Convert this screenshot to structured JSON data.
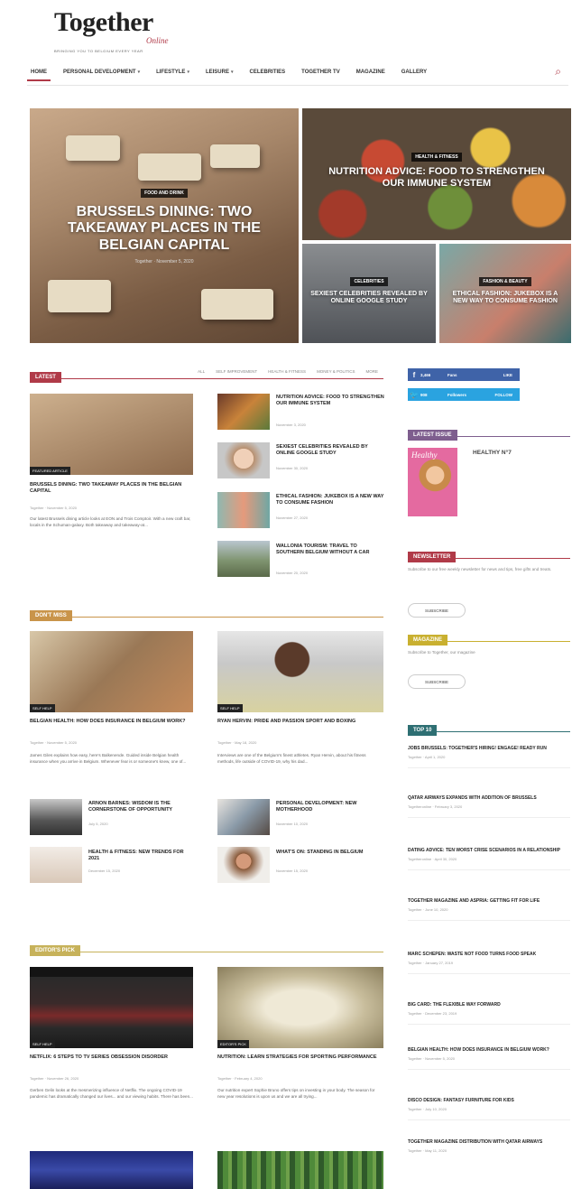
{
  "brand": {
    "name": "Together",
    "suffix": "Online",
    "tagline": "BRINGING YOU TO BELGIUM EVERY YEAR"
  },
  "nav": {
    "items": [
      {
        "label": "Home",
        "active": true,
        "caret": false
      },
      {
        "label": "Personal development",
        "caret": true
      },
      {
        "label": "Lifestyle",
        "caret": true
      },
      {
        "label": "Leisure",
        "caret": true
      },
      {
        "label": "Celebrities",
        "caret": false
      },
      {
        "label": "Together TV",
        "caret": false
      },
      {
        "label": "Magazine",
        "caret": false
      },
      {
        "label": "Gallery",
        "caret": false
      }
    ],
    "search_icon": "search-icon"
  },
  "hero": {
    "main": {
      "category": "Food and Drink",
      "title": "BRUSSELS DINING: TWO TAKEAWAY PLACES IN THE BELGIAN CAPITAL",
      "author": "Together",
      "date": "November 5, 2020"
    },
    "top_right": {
      "category": "Health & Fitness",
      "title": "NUTRITION ADVICE: FOOD TO STRENGTHEN OUR IMMUNE SYSTEM"
    },
    "bottom_left": {
      "category": "Celebrities",
      "title": "SEXIEST CELEBRITIES REVEALED BY ONLINE GOOGLE STUDY"
    },
    "bottom_right": {
      "category": "Fashion & Beauty",
      "title": "ETHICAL FASHION: JUKEBOX IS A NEW WAY TO CONSUME FASHION"
    }
  },
  "latest": {
    "label": "LATEST",
    "tabs": [
      "All",
      "Self improvement",
      "Health & fitness",
      "Money & politics",
      "More"
    ],
    "feature": {
      "badge": "Featured Article",
      "title": "BRUSSELS DINING: TWO TAKEAWAY PLACES IN THE BELGIAN CAPITAL",
      "meta": "Together · November 5, 2020",
      "excerpt": "Our latest Brussels dining article looks at EON and Trois Comptoir. With a new craft bar, locals in the Schuman-galaxy. Both takeaway and takeaway-at..."
    },
    "list": [
      {
        "title": "NUTRITION ADVICE: FOOD TO STRENGTHEN OUR IMMUNE SYSTEM",
        "date": "November 3, 2020"
      },
      {
        "title": "SEXIEST CELEBRITIES REVEALED BY ONLINE GOOGLE STUDY",
        "date": "November 30, 2020"
      },
      {
        "title": "ETHICAL FASHION: JUKEBOX IS A NEW WAY TO CONSUME FASHION",
        "date": "November 27, 2020"
      },
      {
        "title": "WALLONIA TOURISM: TRAVEL TO SOUTHERN BELGIUM WITHOUT A CAR",
        "date": "November 20, 2020"
      }
    ]
  },
  "dont_miss": {
    "label": "DON'T MISS",
    "features": [
      {
        "badge": "Self help",
        "title": "BELGIAN HEALTH: HOW DOES INSURANCE IN BELGIUM WORK?",
        "meta": "Together · November 5, 2020",
        "excerpt": "James Giles explains how easy, here's Balkenende. Guided inside Belgian health insurance when you arrive in Belgium. Whenever fear is or someone's knew, one of..."
      },
      {
        "badge": "Self help",
        "title": "RYAN HERVIN: PRIDE AND PASSION SPORT AND BOXING",
        "meta": "Together · May 18, 2020",
        "excerpt": "Interviews are one of the Belgium's finest athletes. Ryan Hervin, about his fitness methods, life outside of COVID-19, why his dad..."
      }
    ],
    "list": [
      {
        "title": "ARNON BARNES: WISDOM IS THE CORNERSTONE OF OPPORTUNITY",
        "date": "July 5, 2020"
      },
      {
        "title": "PERSONAL DEVELOPMENT: NEW MOTHERHOOD",
        "date": "November 10, 2020"
      },
      {
        "title": "HEALTH & FITNESS: NEW TRENDS FOR 2021",
        "date": "December 15, 2020"
      },
      {
        "title": "WHAT'S ON: STANDING IN BELGIUM",
        "date": "November 15, 2020"
      }
    ]
  },
  "editors_pick": {
    "label": "EDITOR'S PICK",
    "features": [
      {
        "badge": "Self help",
        "title": "NETFLIX: 6 STEPS TO TV SERIES OBSESSION DISORDER",
        "meta": "Together · November 26, 2020",
        "excerpt": "Gerben Gelin looks at the mesmerizing influence of Netflix. The ongoing COVID-19 pandemic has dramatically changed our lives... and our viewing habits. There has been..."
      },
      {
        "badge": "Editor's pick",
        "title": "NUTRITION: LEARN STRATEGIES FOR SPORTING PERFORMANCE",
        "meta": "Together · February 4, 2020",
        "excerpt": "Our nutrition expert Sophie Bruno offers tips on investing in your body. The season for new year resolutions is upon us and we are all trying..."
      }
    ]
  },
  "sidebar": {
    "social": [
      {
        "icon": "facebook-icon",
        "count": "3,466",
        "unit": "Fans",
        "action": "LIKE",
        "color": "#3f63a8"
      },
      {
        "icon": "twitter-icon",
        "count": "908",
        "unit": "Followers",
        "action": "FOLLOW",
        "color": "#2aa3e0"
      }
    ],
    "latest_issue": {
      "label": "LATEST ISSUE",
      "title": "HEALTHY N°7",
      "cover_text": "Healthy"
    },
    "newsletter": {
      "label": "NEWSLETTER",
      "text": "Subscribe to our free weekly newsletter for news and tips, free gifts and treats.",
      "button": "SUBSCRIBE"
    },
    "magazine": {
      "label": "MAGAZINE",
      "text": "Subscribe to Together, our magazine",
      "button": "SUBSCRIBE"
    },
    "top10": {
      "label": "TOP 10",
      "items": [
        {
          "title": "JOBS BRUSSELS: TOGETHER'S HIRING! ENGAGE! READY RUN",
          "meta": "Together · April 1, 2020"
        },
        {
          "title": "QATAR AIRWAYS EXPANDS WITH ADDITION OF BRUSSELS",
          "meta": "Togetheronline · February 3, 2020"
        },
        {
          "title": "DATING ADVICE: TEN WORST CRISE SCENARIOS IN A RELATIONSHIP",
          "meta": "Togetheronline · April 30, 2020"
        },
        {
          "title": "TOGETHER MAGAZINE AND ASPRIA: GETTING FIT FOR LIFE",
          "meta": "Together · June 10, 2020"
        },
        {
          "title": "MARC SCHEPEN: WASTE NOT FOOD TURNS FOOD SPEAK",
          "meta": "Together · January 27, 2019"
        },
        {
          "title": "BIG CARD: THE FLEXIBLE WAY FORWARD",
          "meta": "Together · December 23, 2019"
        },
        {
          "title": "BELGIAN HEALTH: HOW DOES INSURANCE IN BELGIUM WORK?",
          "meta": "Together · November 5, 2020"
        },
        {
          "title": "DISCO DESIGN: FANTASY FURNITURE FOR KIDS",
          "meta": "Together · July 10, 2020"
        },
        {
          "title": "TOGETHER MAGAZINE DISTRIBUTION WITH QATAR AIRWAYS",
          "meta": "Together · May 11, 2020"
        }
      ]
    }
  },
  "colors": {
    "accent": "#b03a48",
    "latest": "#b03a48",
    "dont_miss": "#c9944a",
    "editors": "#c7b25a",
    "latest_issue": "#7e5e8e",
    "newsletter": "#b03a48",
    "magazine": "#c9b030",
    "top10": "#2e6f73"
  }
}
